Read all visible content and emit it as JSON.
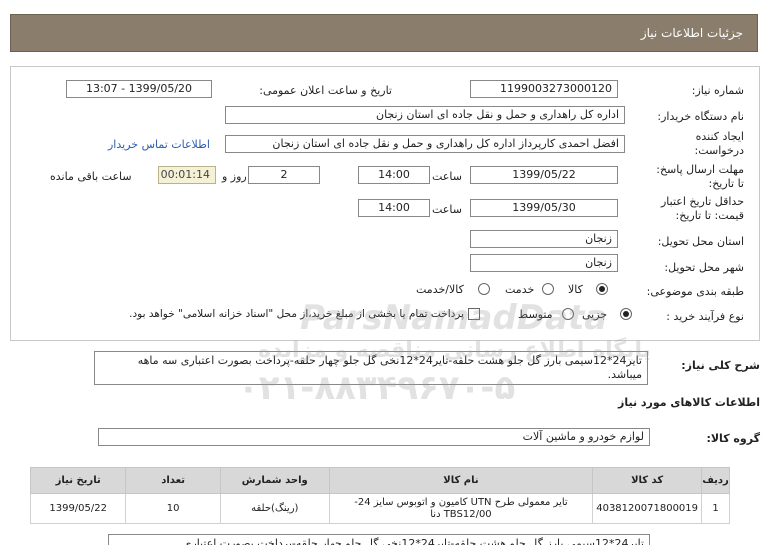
{
  "header": {
    "title": "جزئیات اطلاعات نیاز"
  },
  "form": {
    "need_number": {
      "label": "شماره نیاز:",
      "value": "1199003273000120"
    },
    "announce": {
      "label": "تاریخ و ساعت اعلان عمومی:",
      "value": "1399/05/20 - 13:07"
    },
    "buyer_org": {
      "label": "نام دستگاه خریدار:",
      "value": "اداره کل راهداری و حمل و نقل جاده ای استان زنجان"
    },
    "creator": {
      "label_line1": "ایجاد کننده",
      "label_line2": "درخواست:",
      "value": "افضل احمدی کارپرداز اداره کل راهداری و حمل و نقل جاده ای استان زنجان",
      "contact_link": "اطلاعات تماس خریدار"
    },
    "deadline": {
      "label_line1": "مهلت ارسال پاسخ:",
      "label_line2": "تا تاریخ:",
      "date": "1399/05/22",
      "time_label": "ساعت",
      "time": "14:00",
      "days": "2",
      "days_label": "روز و",
      "remaining": "00:01:14",
      "remaining_label": "ساعت باقی مانده"
    },
    "validity": {
      "label_line1": "حداقل تاریخ اعتبار",
      "label_line2": "قیمت: تا تاریخ:",
      "date": "1399/05/30",
      "time_label": "ساعت",
      "time": "14:00"
    },
    "province": {
      "label": "استان محل تحویل:",
      "value": "زنجان"
    },
    "city": {
      "label": "شهر محل تحویل:",
      "value": "زنجان"
    },
    "category": {
      "label": "طبقه بندی موضوعی:",
      "options": [
        "کالا",
        "خدمت",
        "کالا/خدمت"
      ],
      "selected": "کالا"
    },
    "process": {
      "label": "نوع فرآیند خرید :",
      "options": [
        "جزیی",
        "متوسط"
      ],
      "selected": "جزیی",
      "payment_note": "پرداخت تمام یا بخشی از مبلغ خرید،از محل \"اسناد خزانه اسلامی\" خواهد بود."
    }
  },
  "description": {
    "label": "شرح کلی نیاز:",
    "text": "تایر24*12سیمی بارز گل جلو هشت حلقه-تایر24*12نخی گل جلو چهار حلقه-پرداخت بصورت اعتباری سه ماهه میباشد."
  },
  "goods_info": {
    "title": "اطلاعات کالاهای مورد نیاز"
  },
  "goods_group": {
    "label": "گروه کالا:",
    "value": "لوازم خودرو و ماشین آلات"
  },
  "table": {
    "headers": [
      "ردیف",
      "کد کالا",
      "نام کالا",
      "واحد شمارش",
      "تعداد",
      "تاریخ نیاز"
    ],
    "rows": [
      [
        "1",
        "4038120071800019",
        "تایر معمولی طرح UTN کامیون و اتوبوس سایز 24-TBS12/00 دنا",
        "(رینگ)حلقه",
        "10",
        "1399/05/22"
      ]
    ]
  },
  "bottom_snippet": "تایر24*12سیمی بارز گل جلو هشت حلقه-تایر24*12نخی گل جلو چهار حلقه-پرداخت بصورت اعتباری",
  "watermark": {
    "brand": "ParsNamadData",
    "line1": "پایگاه اطلاع رسانی مناقصه و مزایده",
    "phone": "۰۲۱-۸۸۳۴۹۶۷۰-۵"
  }
}
